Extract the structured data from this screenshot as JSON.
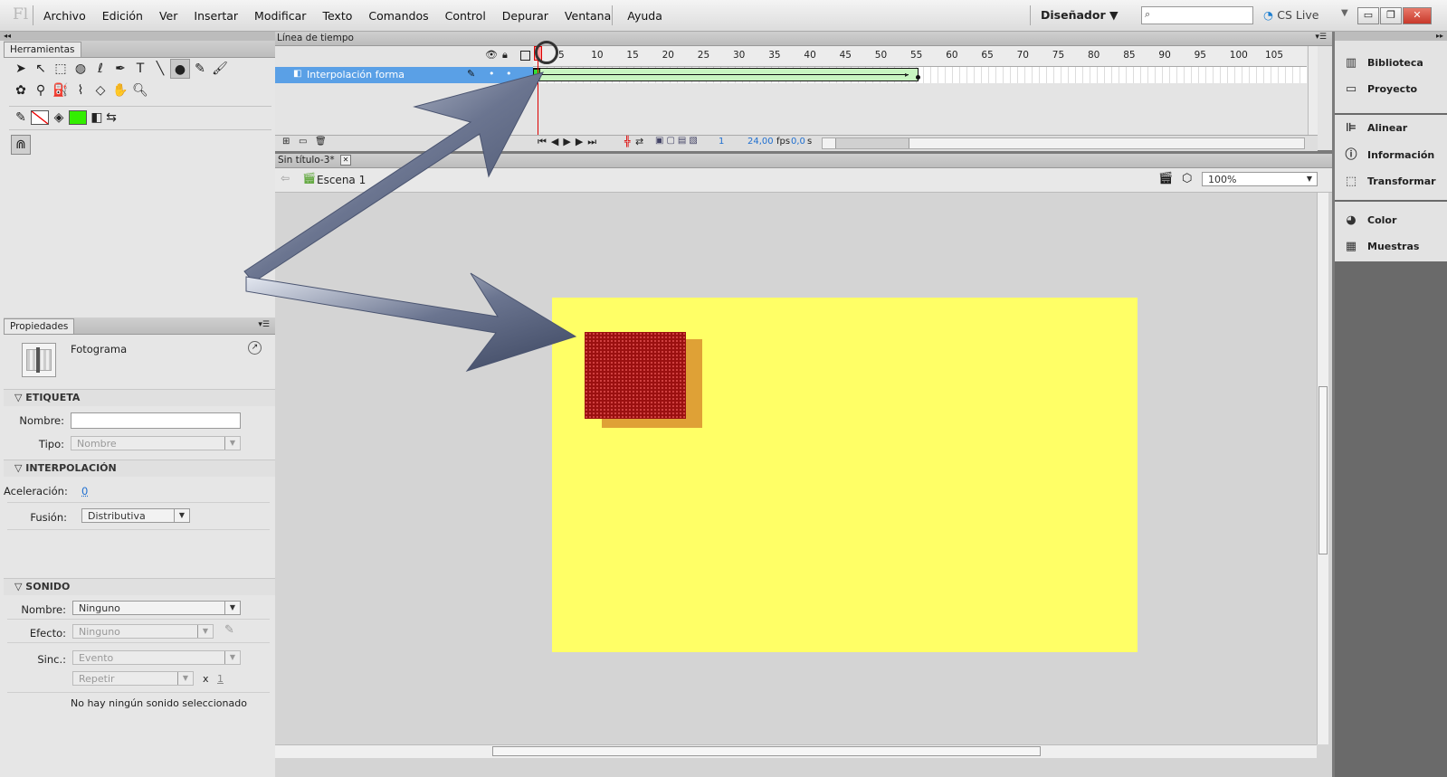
{
  "app": {
    "logo": "Fl"
  },
  "menu": [
    "Archivo",
    "Edición",
    "Ver",
    "Insertar",
    "Modificar",
    "Texto",
    "Comandos",
    "Control",
    "Depurar",
    "Ventana",
    "Ayuda"
  ],
  "workspace": {
    "label": "Diseñador ▼"
  },
  "cslive": {
    "label": "CS Live"
  },
  "tools_panel": {
    "title": "Herramientas"
  },
  "timeline": {
    "title": "Línea de tiempo",
    "ruler": [
      "5",
      "10",
      "15",
      "20",
      "25",
      "30",
      "35",
      "40",
      "45",
      "50",
      "55",
      "60",
      "65",
      "70",
      "75",
      "80",
      "85",
      "90",
      "95",
      "100",
      "105"
    ],
    "layer_name": "Interpolación forma",
    "current_frame": "1",
    "fps": "24,00",
    "fps_unit": "fps",
    "time": "0,0",
    "time_unit": "s"
  },
  "document": {
    "tab": "Sin título-3*",
    "scene": "Escena 1",
    "zoom": "100%"
  },
  "properties": {
    "title": "Propiedades",
    "type": "Fotograma",
    "section_label": "ETIQUETA",
    "name_label": "Nombre:",
    "name_value": "",
    "type_label": "Tipo:",
    "type_value": "Nombre",
    "section_tween": "INTERPOLACIÓN",
    "ease_label": "Aceleración:",
    "ease_value": "0",
    "blend_label": "Fusión:",
    "blend_value": "Distributiva",
    "section_sound": "SONIDO",
    "sound_name_label": "Nombre:",
    "sound_name_value": "Ninguno",
    "effect_label": "Efecto:",
    "effect_value": "Ninguno",
    "sync_label": "Sinc.:",
    "sync_value": "Evento",
    "repeat_value": "Repetir",
    "x_label": "x",
    "repeat_count": "1",
    "no_sound": "No hay ningún sonido seleccionado"
  },
  "right_panels": [
    "Biblioteca",
    "Proyecto",
    "Alinear",
    "Información",
    "Transformar",
    "Color",
    "Muestras"
  ],
  "colors": {
    "stage": "#ffff66",
    "shape": "#9b1010",
    "shape_shadow": "#d4882a",
    "layer_highlight": "#5aa0e6",
    "fill_swatch": "#33ee00"
  }
}
